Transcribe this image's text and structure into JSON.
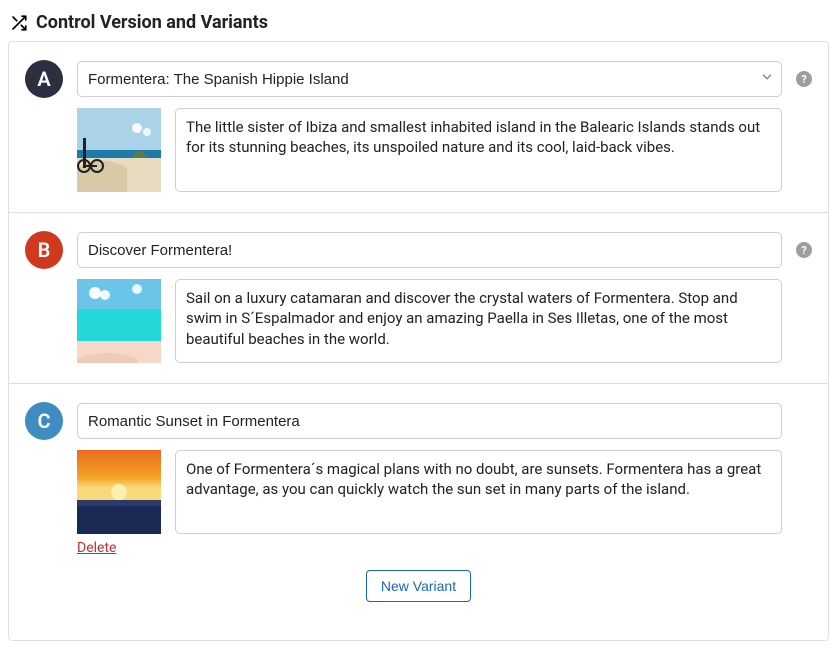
{
  "header": {
    "title": "Control Version and Variants"
  },
  "variants": [
    {
      "letter": "A",
      "badgeColor": "#2b2f3f",
      "title": "Formentera: The Spanish Hippie Island",
      "isSelect": true,
      "description": "The little sister of Ibiza and smallest inhabited island in the Balearic Islands stands out for its stunning beaches, its unspoiled nature and its cool, laid-back vibes.",
      "showHelp": true,
      "showDelete": false
    },
    {
      "letter": "B",
      "badgeColor": "#cf3a1f",
      "title": "Discover Formentera!",
      "isSelect": false,
      "description": "Sail on a luxury catamaran and discover the crystal waters of Formentera. Stop and swim in S´Espalmador and enjoy an amazing Paella in Ses Illetas, one of the most beautiful beaches in the world.",
      "showHelp": true,
      "showDelete": false
    },
    {
      "letter": "C",
      "badgeColor": "#3f8cc2",
      "title": "Romantic Sunset in Formentera",
      "isSelect": false,
      "description": "One of Formentera´s magical plans with no doubt, are sunsets. Formentera has a great advantage, as you can quickly watch the sun set in many parts of the island.",
      "showHelp": false,
      "showDelete": true
    }
  ],
  "labels": {
    "delete": "Delete",
    "newVariant": "New Variant",
    "help": "?"
  }
}
